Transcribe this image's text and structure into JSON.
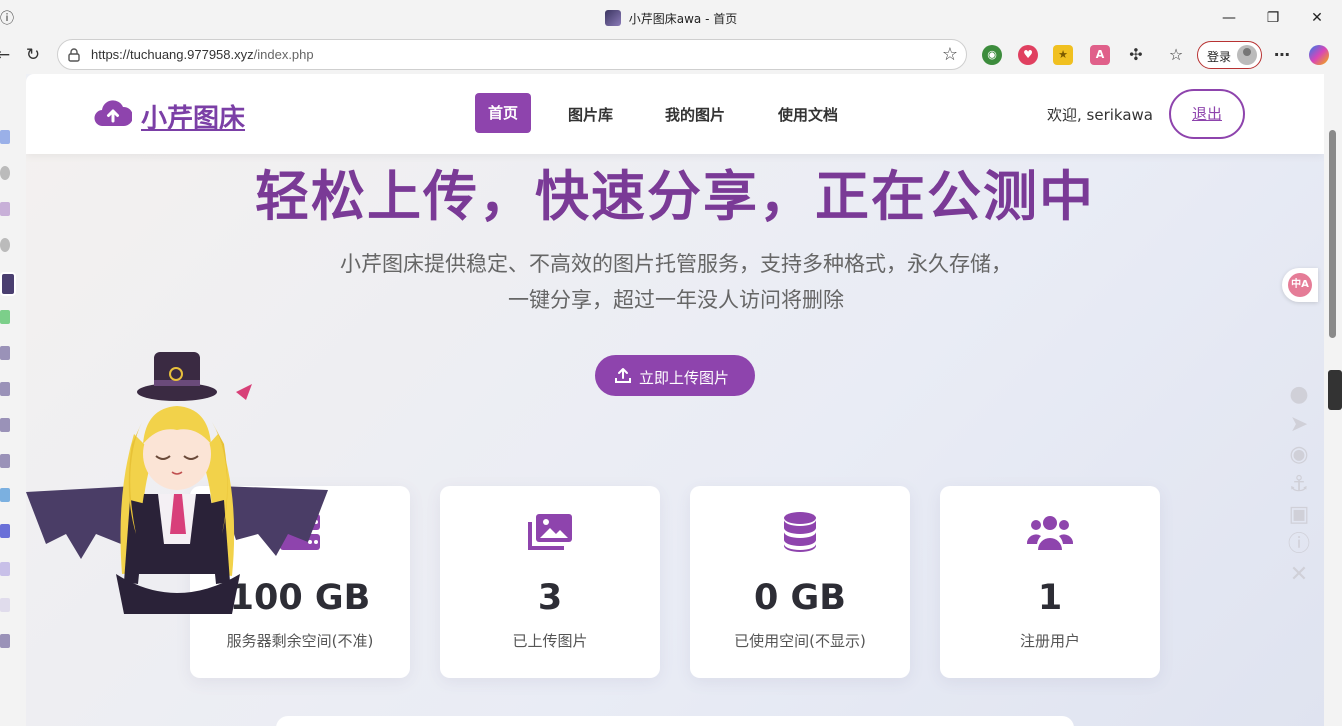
{
  "browser": {
    "tab_title": "小芹图床awa - 首页",
    "url_host": "https://tuchuang.977958.xyz",
    "url_path": "/index.php",
    "login_label": "登录"
  },
  "site": {
    "logo_text": "小芹图床",
    "nav": [
      {
        "label": "首页",
        "active": true
      },
      {
        "label": "图片库"
      },
      {
        "label": "我的图片"
      },
      {
        "label": "使用文档"
      }
    ],
    "welcome": "欢迎, serikawa",
    "logout": "退出"
  },
  "hero": {
    "title": "轻松上传，快速分享，正在公测中",
    "subtitle": "小芹图床提供稳定、不高效的图片托管服务，支持多种格式，永久存储，一键分享，超过一年没人访问将删除",
    "cta": "立即上传图片"
  },
  "stats": [
    {
      "icon": "server-icon",
      "value": "100 GB",
      "label": "服务器剩余空间(不准)"
    },
    {
      "icon": "images-icon",
      "value": "3",
      "label": "已上传图片"
    },
    {
      "icon": "database-icon",
      "value": "0 GB",
      "label": "已使用空间(不显示)"
    },
    {
      "icon": "users-icon",
      "value": "1",
      "label": "注册用户"
    }
  ],
  "colors": {
    "accent": "#8e44ad",
    "title": "#7a3a96"
  },
  "translate_label": "中A"
}
